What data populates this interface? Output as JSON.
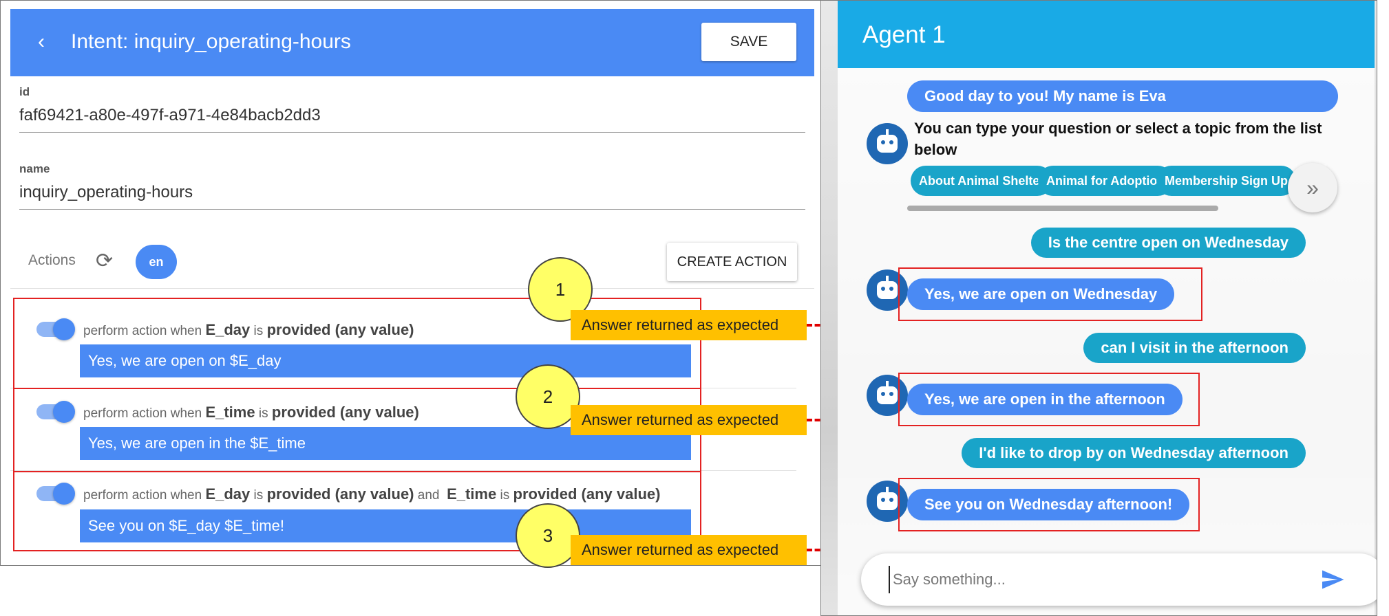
{
  "intent_editor": {
    "back_glyph": "‹",
    "title": "Intent: inquiry_operating-hours",
    "save_label": "SAVE",
    "fields": {
      "id_label": "id",
      "id_value": "faf69421-a80e-497f-a971-4e84bacb2dd3",
      "name_label": "name",
      "name_value": "inquiry_operating-hours"
    },
    "actions_label": "Actions",
    "sync_icon": "⟳",
    "language_chip": "en",
    "create_action_label": "CREATE ACTION",
    "actions": [
      {
        "enabled": true,
        "prefix": "perform action when",
        "entity": "E_day",
        "is": "is",
        "condition": "provided (any value)",
        "response": "Yes, we are open on $E_day"
      },
      {
        "enabled": true,
        "prefix": "perform action when",
        "entity": "E_time",
        "is": "is",
        "condition": "provided (any value)",
        "response": "Yes, we are open in the $E_time"
      },
      {
        "enabled": true,
        "prefix": "perform action when",
        "entity": "E_day",
        "is": "is",
        "condition": "provided (any value)",
        "and": "and",
        "entity2": "E_time",
        "is2": "is",
        "condition2": "provided (any value)",
        "response": "See you on $E_day $E_time!"
      }
    ]
  },
  "annotations": [
    {
      "number": "1",
      "note": "Answer returned as expected"
    },
    {
      "number": "2",
      "note": "Answer returned as expected"
    },
    {
      "number": "3",
      "note": "Answer returned as expected"
    }
  ],
  "chat": {
    "agent_title": "Agent 1",
    "greeting": "Good day to you! My name is Eva",
    "intro": "You can type your question or select a topic from the list below",
    "topics": [
      "About Animal Shelter",
      "Animal for Adoption",
      "Membership Sign Up"
    ],
    "next_glyph": "»",
    "messages": [
      {
        "from": "user",
        "text": "Is the centre open on Wednesday"
      },
      {
        "from": "bot",
        "text": "Yes, we are open on Wednesday"
      },
      {
        "from": "user",
        "text": "can I visit in the afternoon"
      },
      {
        "from": "bot",
        "text": "Yes, we are open in the afternoon"
      },
      {
        "from": "user",
        "text": "I'd like to drop by on Wednesday afternoon"
      },
      {
        "from": "bot",
        "text": "See you on Wednesday afternoon!"
      }
    ],
    "input_placeholder": "Say something...",
    "send_icon": "send-icon"
  },
  "colors": {
    "primary": "#4a8af4",
    "chat_header": "#19aae6",
    "user_bubble": "#19a4c9",
    "highlight_box": "#e32222",
    "note_fill": "#ffc000",
    "callout_circle": "#ffff66"
  }
}
